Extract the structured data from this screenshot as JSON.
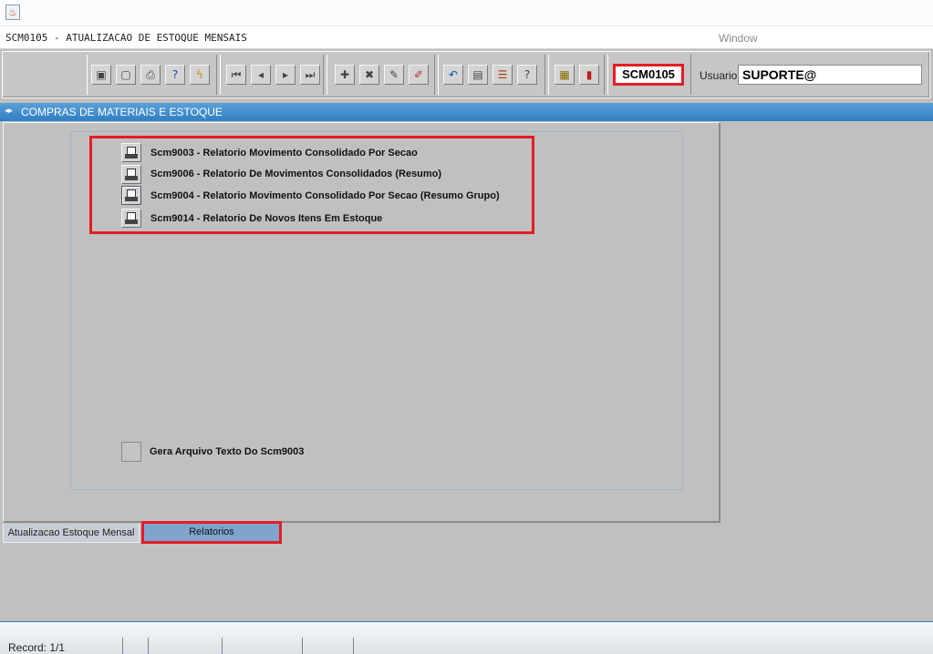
{
  "app": {
    "form_title": "SCM0105 - ATUALIZACAO DE ESTOQUE MENSAIS",
    "menu_window": "Window"
  },
  "toolbar": {
    "buttons": [
      {
        "icon": "save-icon"
      },
      {
        "icon": "print-screen-icon"
      },
      {
        "icon": "printer-icon"
      },
      {
        "icon": "query-help-icon"
      },
      {
        "icon": "execute-query-icon"
      },
      {
        "icon": "first-record-icon"
      },
      {
        "icon": "previous-record-icon"
      },
      {
        "icon": "next-record-icon"
      },
      {
        "icon": "last-record-icon"
      },
      {
        "icon": "insert-record-icon"
      },
      {
        "icon": "delete-record-icon"
      },
      {
        "icon": "edit-record-icon"
      },
      {
        "icon": "clear-record-icon"
      },
      {
        "icon": "undo-icon"
      },
      {
        "icon": "clipboard-icon"
      },
      {
        "icon": "list-values-icon"
      },
      {
        "icon": "help-icon"
      },
      {
        "icon": "menu-icon"
      },
      {
        "icon": "exit-icon"
      }
    ],
    "form_code": "SCM0105",
    "usuario_label": "Usuario",
    "usuario_value": "SUPORTE@"
  },
  "section": {
    "title": "COMPRAS DE MATERIAIS E ESTOQUE"
  },
  "reports": [
    {
      "label": "Scm9003 - Relatorio Movimento Consolidado Por Secao"
    },
    {
      "label": "Scm9006 - Relatorio De Movimentos Consolidados (Resumo)"
    },
    {
      "label": "Scm9004 - Relatorio Movimento Consolidado Por Secao (Resumo Grupo)"
    },
    {
      "label": "Scm9014 - Relatorio De Novos Itens Em Estoque"
    }
  ],
  "gera_arquivo": {
    "label": "Gera Arquivo Texto Do Scm9003",
    "checked": false
  },
  "tabs": [
    {
      "label": "Atualizacao Estoque Mensal",
      "active": false
    },
    {
      "label": "Relatorios",
      "active": true
    }
  ],
  "status": {
    "record": "Record: 1/1"
  },
  "colors": {
    "highlight": "#e31d25",
    "header_blue": "#2f7fc3",
    "active_tab": "#7fa5cf"
  }
}
